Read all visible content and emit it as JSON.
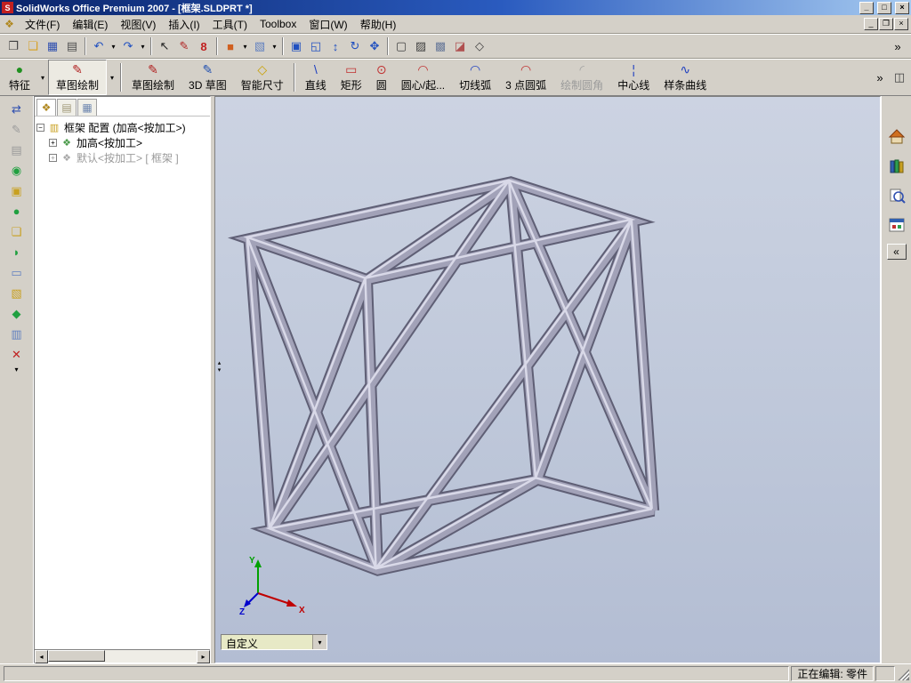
{
  "titlebar": {
    "app_icon": "S",
    "title": "SolidWorks Office Premium 2007 - [框架.SLDPRT *]",
    "minimize": "_",
    "maximize": "□",
    "close": "×"
  },
  "menubar": {
    "doc_icon": "❖",
    "items": [
      "文件(F)",
      "编辑(E)",
      "视图(V)",
      "插入(I)",
      "工具(T)",
      "Toolbox",
      "窗口(W)",
      "帮助(H)"
    ],
    "doc_minimize": "_",
    "doc_restore": "❐",
    "doc_close": "×"
  },
  "toolbar_standard": {
    "dropdown": "▾",
    "overflow": "»",
    "buttons": [
      {
        "name": "new",
        "glyph": "❐"
      },
      {
        "name": "open",
        "glyph": "❏"
      },
      {
        "name": "save",
        "glyph": "▦"
      },
      {
        "name": "print",
        "glyph": "▤"
      },
      {
        "name": "undo",
        "glyph": "↶"
      },
      {
        "name": "redo",
        "glyph": "↷"
      },
      {
        "name": "select",
        "glyph": "↖"
      },
      {
        "name": "sketch",
        "glyph": "✎"
      },
      {
        "name": "rebuild",
        "glyph": "8"
      },
      {
        "name": "appearance",
        "glyph": "■"
      },
      {
        "name": "scene",
        "glyph": "▧"
      },
      {
        "name": "zoom-fit",
        "glyph": "▣"
      },
      {
        "name": "zoom-area",
        "glyph": "◱"
      },
      {
        "name": "zoom-in-out",
        "glyph": "↕"
      },
      {
        "name": "rotate-view",
        "glyph": "↻"
      },
      {
        "name": "pan",
        "glyph": "✥"
      },
      {
        "name": "wireframe",
        "glyph": "▢"
      },
      {
        "name": "hidden-lines",
        "glyph": "▨"
      },
      {
        "name": "shaded",
        "glyph": "▩"
      },
      {
        "name": "section-view",
        "glyph": "◪"
      },
      {
        "name": "view-orientation",
        "glyph": "◇"
      }
    ]
  },
  "toolbar_sketch": {
    "dropdown": "▾",
    "overflow": "»",
    "right_button_glyph": "◫",
    "buttons": [
      {
        "label": "特征",
        "glyph": "●"
      },
      {
        "label": "草图绘制",
        "glyph": "✎"
      },
      {
        "label": "草图绘制",
        "glyph": "✎"
      },
      {
        "label": "3D 草图",
        "glyph": "✎"
      },
      {
        "label": "智能尺寸",
        "glyph": "◇"
      },
      {
        "label": "直线",
        "glyph": "\\"
      },
      {
        "label": "矩形",
        "glyph": "▭"
      },
      {
        "label": "圆",
        "glyph": "⊙"
      },
      {
        "label": "圆心/起...",
        "glyph": "◠"
      },
      {
        "label": "切线弧",
        "glyph": "◠"
      },
      {
        "label": "3 点圆弧",
        "glyph": "◠"
      },
      {
        "label": "绘制圆角",
        "glyph": "◜"
      },
      {
        "label": "中心线",
        "glyph": "¦"
      },
      {
        "label": "样条曲线",
        "glyph": "∿"
      }
    ]
  },
  "sidebar_tools": [
    {
      "glyph": "⇄"
    },
    {
      "glyph": "✎"
    },
    {
      "glyph": "▤"
    },
    {
      "glyph": "◉"
    },
    {
      "glyph": "▣"
    },
    {
      "glyph": "●"
    },
    {
      "glyph": "❏"
    },
    {
      "glyph": "◗"
    },
    {
      "glyph": "▭"
    },
    {
      "glyph": "▧"
    },
    {
      "glyph": "◆"
    },
    {
      "glyph": "▥"
    },
    {
      "glyph": "✕"
    }
  ],
  "feature_tree": {
    "tabs": [
      {
        "glyph": "❖"
      },
      {
        "glyph": "▤"
      },
      {
        "glyph": "▦"
      }
    ],
    "expand_open": "−",
    "expand_closed": "+",
    "root": {
      "icon": "▥",
      "label": "框架 配置 (加高<按加工>)"
    },
    "children": [
      {
        "icon": "❖",
        "label": "加高<按加工>"
      },
      {
        "icon": "❖",
        "label": "默认<按加工> [ 框架 ]"
      }
    ],
    "scroll_left": "◂",
    "scroll_right": "▸"
  },
  "viewport": {
    "combo_value": "自定义",
    "combo_arrow": "▾",
    "splitter_up": "▴",
    "splitter_down": "▾",
    "triad": {
      "x": "X",
      "y": "Y",
      "z": "Z"
    }
  },
  "taskpane": {
    "collapse": "«"
  },
  "statusbar": {
    "editing": "正在编辑: 零件"
  },
  "colors": {
    "titlebar_left": "#0a246a",
    "titlebar_right": "#a6caf0",
    "chrome": "#d4d0c8",
    "viewport_top": "#ccd3e2",
    "viewport_bottom": "#b3bdd3",
    "frame_face": "#a2a2b8",
    "frame_edge": "#5f5f75"
  }
}
